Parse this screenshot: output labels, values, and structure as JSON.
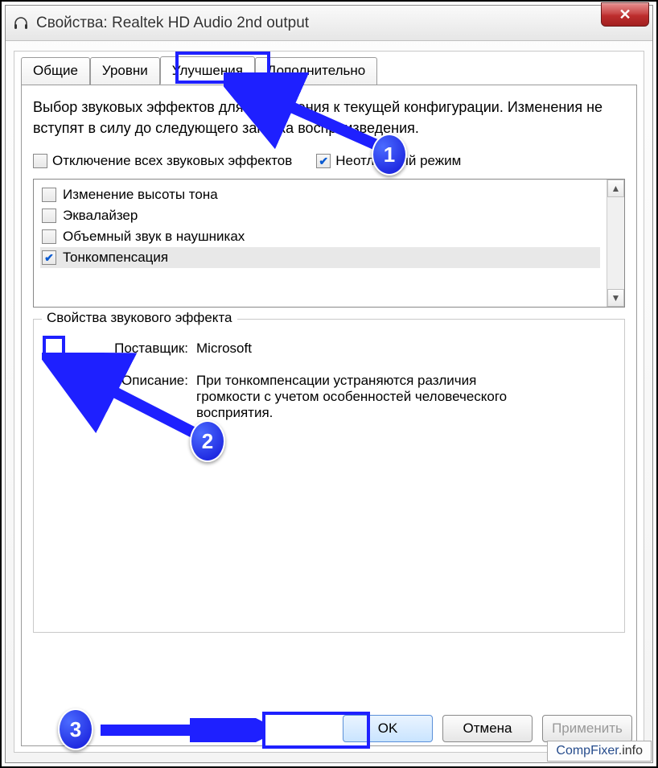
{
  "window": {
    "title": "Свойства: Realtek HD Audio 2nd output"
  },
  "tabs": {
    "general": "Общие",
    "levels": "Уровни",
    "enhancements": "Улучшения",
    "advanced": "Дополнительно"
  },
  "panel": {
    "description": "Выбор звуковых эффектов для применения к текущей конфигурации. Изменения не вступят в силу до следующего запуска воспроизведения."
  },
  "top_checks": {
    "disable_all": {
      "label": "Отключение всех звуковых эффектов",
      "checked": false
    },
    "immediate": {
      "label": "Неотложный режим",
      "checked": true
    }
  },
  "effects": [
    {
      "label": "Изменение высоты тона",
      "checked": false
    },
    {
      "label": "Эквалайзер",
      "checked": false
    },
    {
      "label": "Объемный звук в наушниках",
      "checked": false
    },
    {
      "label": "Тонкомпенсация",
      "checked": true,
      "selected": true
    }
  ],
  "details": {
    "legend": "Свойства звукового эффекта",
    "provider_label": "Поставщик:",
    "provider_value": "Microsoft",
    "desc_label": "Описание:",
    "desc_value": "При тонкомпенсации устраняются различия громкости с учетом особенностей человеческого восприятия."
  },
  "buttons": {
    "ok": "OK",
    "cancel": "Отмена",
    "apply": "Применить"
  },
  "annotations": {
    "n1": "1",
    "n2": "2",
    "n3": "3"
  },
  "watermark": {
    "part1": "CompFixer",
    "part2": ".info"
  }
}
